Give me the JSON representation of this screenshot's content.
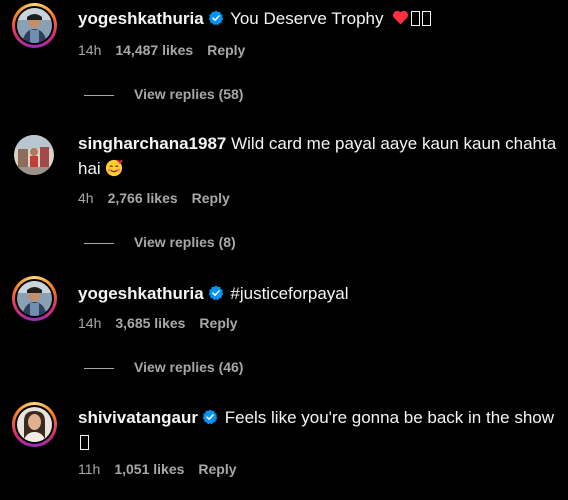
{
  "comments": [
    {
      "username": "yogeshkathuria",
      "verified": true,
      "text": "You Deserve Trophy",
      "time": "14h",
      "likes": "14,487 likes",
      "reply_label": "Reply",
      "view_replies": "View replies (58)"
    },
    {
      "username": "singharchana1987",
      "verified": false,
      "text": "Wild card me payal aaye kaun kaun chahta hai",
      "time": "4h",
      "likes": "2,766 likes",
      "reply_label": "Reply",
      "view_replies": "View replies (8)"
    },
    {
      "username": "yogeshkathuria",
      "verified": true,
      "text": "#justiceforpayal",
      "time": "14h",
      "likes": "3,685 likes",
      "reply_label": "Reply",
      "view_replies": "View replies (46)"
    },
    {
      "username": "shivivatangaur",
      "verified": true,
      "text": "Feels like you're gonna be back in the show",
      "time": "11h",
      "likes": "1,051 likes",
      "reply_label": "Reply"
    }
  ],
  "colors": {
    "background": "#000000",
    "text": "#f5f5f5",
    "secondary": "#a8a8a8",
    "verified": "#0095f6",
    "heart": "#ff3040"
  }
}
